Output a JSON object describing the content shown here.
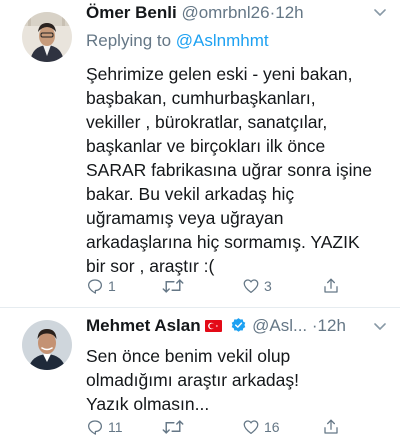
{
  "tweet1": {
    "name": "Ömer Benli",
    "handle": "@omrbnl26",
    "dot": "·",
    "time": "12h",
    "reply_prefix": "Replying to",
    "reply_to": "@Aslnmhmt",
    "lines": [
      "Şehrimize gelen eski - yeni bakan,",
      "başbakan, cumhurbaşkanları,",
      "vekiller , bürokratlar, sanatçılar,",
      "başkanlar ve birçokları ilk önce",
      "SARAR fabrikasına uğrar sonra işine",
      "bakar. Bu vekil arkadaş hiç",
      "uğramamış veya uğrayan",
      "arkadaşlarına hiç sormamış. YAZIK",
      "bir sor , araştır :("
    ],
    "reply_count": "1",
    "retweet_count": "",
    "like_count": "3"
  },
  "tweet2": {
    "name": "Mehmet Aslan",
    "handle": "@Asl...",
    "dot": "·",
    "time": "12h",
    "lines": [
      "Sen önce benim vekil olup",
      "olmadığımı araştır arkadaş!",
      "Yazık olmasın..."
    ],
    "reply_count": "11",
    "retweet_count": "",
    "like_count": "16"
  },
  "icons": {
    "reply": "reply-icon",
    "retweet": "retweet-icon",
    "like": "heart-icon",
    "share": "share-icon",
    "more": "chevron-down-icon",
    "verified": "verified-badge-icon",
    "flag": "turkish-flag-icon"
  },
  "colors": {
    "text": "#14171a",
    "secondary": "#657786",
    "link": "#1da1f2",
    "separator": "#e6ecf0",
    "flag_red": "#e30a17"
  }
}
